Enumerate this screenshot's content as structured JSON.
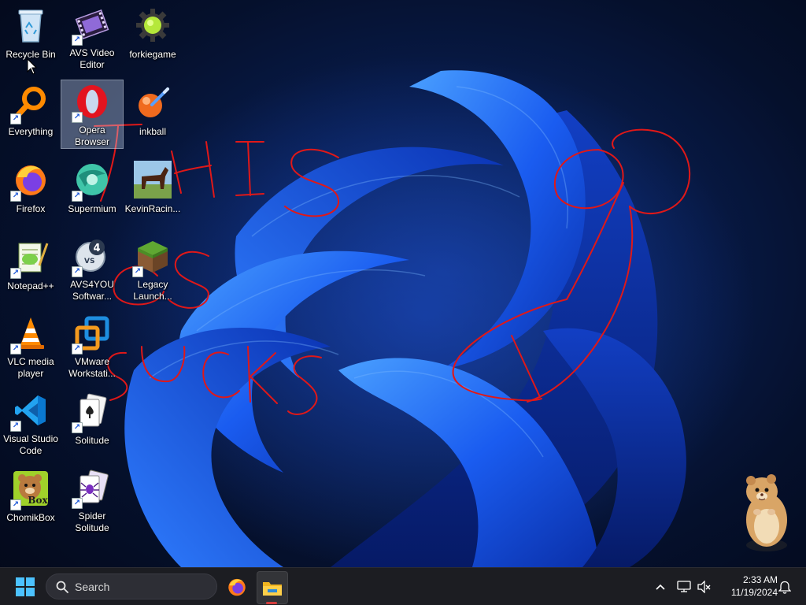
{
  "desktop": {
    "icons": [
      {
        "label": "Recycle Bin",
        "icon": "recycle-bin-icon",
        "shortcut": false
      },
      {
        "label": "AVS Video Editor",
        "icon": "film-strip-icon",
        "shortcut": true
      },
      {
        "label": "forkiegame",
        "icon": "green-gear-icon",
        "shortcut": false
      },
      {
        "label": "Everything",
        "icon": "magnifier-icon",
        "shortcut": true
      },
      {
        "label": "Opera Browser",
        "icon": "opera-icon",
        "shortcut": true,
        "selected": true
      },
      {
        "label": "inkball",
        "icon": "inkball-icon",
        "shortcut": false
      },
      {
        "label": "Firefox",
        "icon": "firefox-icon",
        "shortcut": true
      },
      {
        "label": "Supermium",
        "icon": "supermium-icon",
        "shortcut": true
      },
      {
        "label": "KevinRacin...",
        "icon": "horse-photo-icon",
        "shortcut": false
      },
      {
        "label": "Notepad++",
        "icon": "notepad-plus-plus-icon",
        "shortcut": true
      },
      {
        "label": "AVS4YOU Softwar...",
        "icon": "avs4you-icon",
        "shortcut": true
      },
      {
        "label": "Legacy Launch...",
        "icon": "minecraft-block-icon",
        "shortcut": true
      },
      {
        "label": "VLC media player",
        "icon": "vlc-cone-icon",
        "shortcut": true
      },
      {
        "label": "VMware Workstati...",
        "icon": "vmware-icon",
        "shortcut": true
      },
      {
        "label": "Visual Studio Code",
        "icon": "vscode-icon",
        "shortcut": true
      },
      {
        "label": "Solitude",
        "icon": "playing-cards-icon",
        "shortcut": true
      },
      {
        "label": "ChomikBox",
        "icon": "chomikbox-icon",
        "shortcut": true
      },
      {
        "label": "Spider Solitude",
        "icon": "spider-cards-icon",
        "shortcut": true
      }
    ],
    "chomikbox_badge": "Box",
    "avs4you_badge": "4",
    "avs4you_vs": "VS",
    "scribble_color": "#e01818"
  },
  "taskbar": {
    "search_placeholder": "Search",
    "time": "2:33 AM",
    "date": "11/19/2024",
    "pinned": [
      "firefox-icon",
      "file-explorer-icon"
    ],
    "tray": [
      "chevron-up-icon",
      "network-icon",
      "volume-muted-icon",
      "notification-bell-icon"
    ],
    "accent": "#0078d4"
  }
}
